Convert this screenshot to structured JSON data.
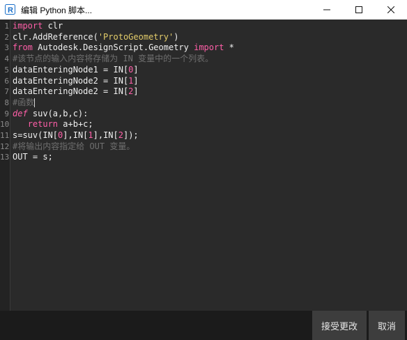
{
  "window": {
    "title": "编辑 Python 脚本...",
    "icon": "revit-r-icon",
    "controls": [
      "minimize-icon",
      "maximize-icon",
      "close-icon"
    ]
  },
  "editor": {
    "lines": [
      {
        "n": "1",
        "segs": [
          {
            "t": "import",
            "c": "kw"
          },
          {
            "t": " clr",
            "c": ""
          }
        ]
      },
      {
        "n": "2",
        "segs": [
          {
            "t": "clr.AddReference(",
            "c": ""
          },
          {
            "t": "'ProtoGeometry'",
            "c": "str"
          },
          {
            "t": ")",
            "c": ""
          }
        ]
      },
      {
        "n": "3",
        "segs": [
          {
            "t": "from",
            "c": "kw"
          },
          {
            "t": " Autodesk.DesignScript.Geometry ",
            "c": ""
          },
          {
            "t": "import",
            "c": "kw"
          },
          {
            "t": " *",
            "c": ""
          }
        ]
      },
      {
        "n": "4",
        "segs": [
          {
            "t": "#该节点的输入内容将存储为 IN 变量中的一个列表。",
            "c": "cm"
          }
        ]
      },
      {
        "n": "5",
        "segs": [
          {
            "t": "dataEnteringNode1 = IN[",
            "c": ""
          },
          {
            "t": "0",
            "c": "num"
          },
          {
            "t": "]",
            "c": ""
          }
        ]
      },
      {
        "n": "6",
        "segs": [
          {
            "t": "dataEnteringNode2 = IN[",
            "c": ""
          },
          {
            "t": "1",
            "c": "num"
          },
          {
            "t": "]",
            "c": ""
          }
        ]
      },
      {
        "n": "7",
        "segs": [
          {
            "t": "dataEnteringNode2 = IN[",
            "c": ""
          },
          {
            "t": "2",
            "c": "num"
          },
          {
            "t": "]",
            "c": ""
          }
        ]
      },
      {
        "n": "8",
        "segs": [
          {
            "t": "#函数",
            "c": "cm"
          },
          {
            "t": "",
            "c": "caret"
          }
        ]
      },
      {
        "n": "9",
        "segs": [
          {
            "t": "def",
            "c": "kwi"
          },
          {
            "t": " suv(a,b,c):",
            "c": ""
          }
        ]
      },
      {
        "n": "10",
        "segs": [
          {
            "t": "   ",
            "c": ""
          },
          {
            "t": "return",
            "c": "kw"
          },
          {
            "t": " a+b+c;",
            "c": ""
          }
        ]
      },
      {
        "n": "11",
        "segs": [
          {
            "t": "s=suv(IN[",
            "c": ""
          },
          {
            "t": "0",
            "c": "num"
          },
          {
            "t": "],IN[",
            "c": ""
          },
          {
            "t": "1",
            "c": "num"
          },
          {
            "t": "],IN[",
            "c": ""
          },
          {
            "t": "2",
            "c": "num"
          },
          {
            "t": "]);",
            "c": ""
          }
        ]
      },
      {
        "n": "12",
        "segs": [
          {
            "t": "#将输出内容指定给 OUT 变量。",
            "c": "cm"
          }
        ]
      },
      {
        "n": "13",
        "segs": [
          {
            "t": "OUT = s;",
            "c": ""
          }
        ]
      }
    ]
  },
  "footer": {
    "accept_label": "接受更改",
    "cancel_label": "取消"
  },
  "colors": {
    "background": "#2a2a2a",
    "keyword": "#ff5fa8",
    "string": "#e3cc6a",
    "comment": "#6f6f6f",
    "text": "#f0f0f0",
    "icon_blue": "#1a6fc9"
  }
}
